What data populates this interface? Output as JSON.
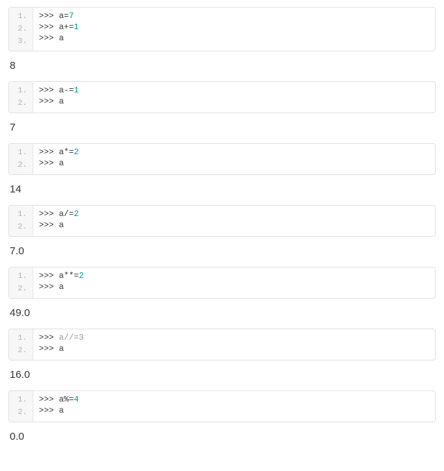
{
  "blocks": [
    {
      "lines": [
        [
          {
            "cls": "tok-prompt",
            "t": ">>> "
          },
          {
            "cls": "tok-text",
            "t": "a="
          },
          {
            "cls": "tok-num",
            "t": "7"
          }
        ],
        [
          {
            "cls": "tok-prompt",
            "t": ">>> "
          },
          {
            "cls": "tok-text",
            "t": "a+="
          },
          {
            "cls": "tok-num",
            "t": "1"
          }
        ],
        [
          {
            "cls": "tok-prompt",
            "t": ">>> "
          },
          {
            "cls": "tok-text",
            "t": "a"
          }
        ]
      ],
      "output": "8"
    },
    {
      "lines": [
        [
          {
            "cls": "tok-prompt",
            "t": ">>> "
          },
          {
            "cls": "tok-text",
            "t": "a-="
          },
          {
            "cls": "tok-num",
            "t": "1"
          }
        ],
        [
          {
            "cls": "tok-prompt",
            "t": ">>> "
          },
          {
            "cls": "tok-text",
            "t": "a"
          }
        ]
      ],
      "output": "7"
    },
    {
      "lines": [
        [
          {
            "cls": "tok-prompt",
            "t": ">>> "
          },
          {
            "cls": "tok-text",
            "t": "a*="
          },
          {
            "cls": "tok-num",
            "t": "2"
          }
        ],
        [
          {
            "cls": "tok-prompt",
            "t": ">>> "
          },
          {
            "cls": "tok-text",
            "t": "a"
          }
        ]
      ],
      "output": "14"
    },
    {
      "lines": [
        [
          {
            "cls": "tok-prompt",
            "t": ">>> "
          },
          {
            "cls": "tok-text",
            "t": "a/="
          },
          {
            "cls": "tok-num",
            "t": "2"
          }
        ],
        [
          {
            "cls": "tok-prompt",
            "t": ">>> "
          },
          {
            "cls": "tok-text",
            "t": "a"
          }
        ]
      ],
      "output": "7.0"
    },
    {
      "lines": [
        [
          {
            "cls": "tok-prompt",
            "t": ">>> "
          },
          {
            "cls": "tok-text",
            "t": "a**="
          },
          {
            "cls": "tok-num",
            "t": "2"
          }
        ],
        [
          {
            "cls": "tok-prompt",
            "t": ">>> "
          },
          {
            "cls": "tok-text",
            "t": "a"
          }
        ]
      ],
      "output": "49.0"
    },
    {
      "lines": [
        [
          {
            "cls": "tok-prompt",
            "t": ">>> "
          },
          {
            "cls": "tok-comment",
            "t": "a//=3"
          }
        ],
        [
          {
            "cls": "tok-prompt",
            "t": ">>> "
          },
          {
            "cls": "tok-text",
            "t": "a"
          }
        ]
      ],
      "output": "16.0"
    },
    {
      "lines": [
        [
          {
            "cls": "tok-prompt",
            "t": ">>> "
          },
          {
            "cls": "tok-text",
            "t": "a%="
          },
          {
            "cls": "tok-num",
            "t": "4"
          }
        ],
        [
          {
            "cls": "tok-prompt",
            "t": ">>> "
          },
          {
            "cls": "tok-text",
            "t": "a"
          }
        ]
      ],
      "output": "0.0"
    }
  ]
}
